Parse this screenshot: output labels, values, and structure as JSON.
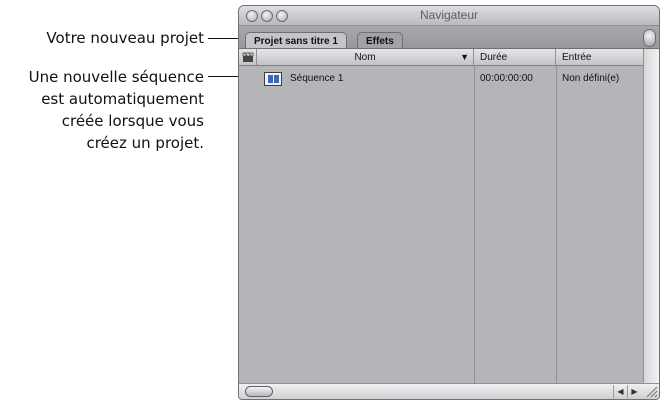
{
  "callouts": {
    "project": "Votre nouveau projet",
    "sequence_lines": [
      "Une nouvelle séquence",
      "est automatiquement",
      "créée lorsque vous",
      "créez un projet."
    ]
  },
  "window": {
    "title": "Navigateur",
    "tabs": [
      {
        "label": "Projet sans titre 1",
        "active": true
      },
      {
        "label": "Effets",
        "active": false
      }
    ],
    "columns": {
      "name": "Nom",
      "sort_arrow": "▼",
      "duration": "Durée",
      "in_point": "Entrée"
    },
    "rows": [
      {
        "name": "Séquence 1",
        "duration": "00:00:00:00",
        "in_point": "Non défini(e)"
      }
    ],
    "scroll_arrows": {
      "left": "◀",
      "right": "▶"
    }
  },
  "colors": {
    "window_bg": "#b7b9bd",
    "sequence_icon_accent": "#3a67b7"
  }
}
